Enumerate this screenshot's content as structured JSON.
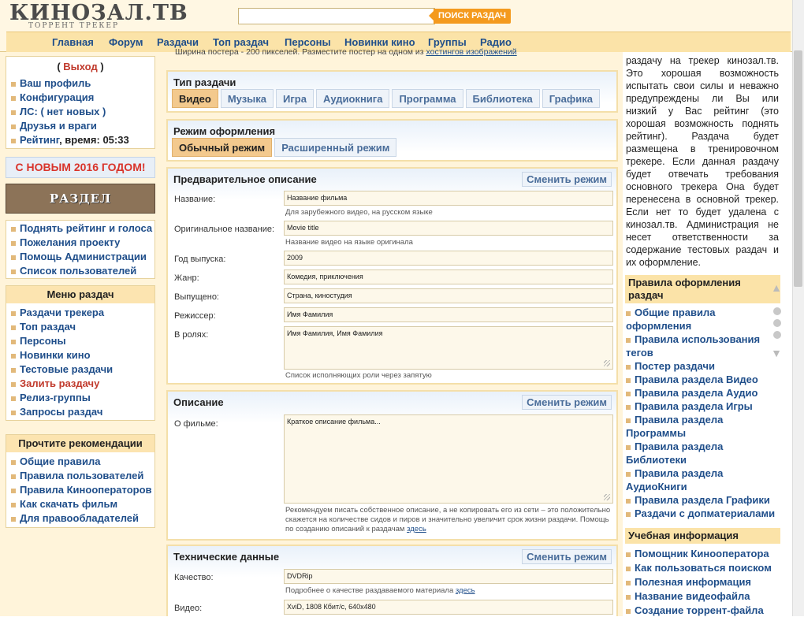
{
  "header": {
    "logo_main": "КИНОЗАЛ.ТВ",
    "logo_sub": "ТОРРЕНТ ТРЕКЕР",
    "search_placeholder": "",
    "search_button": "ПОИСК РАЗДАЧ",
    "nav": [
      "Главная",
      "Форум",
      "Раздачи",
      "Топ раздач",
      "Персоны",
      "Новинки кино",
      "Группы",
      "Радио"
    ]
  },
  "left": {
    "logout": "Выход",
    "user_links": [
      "Ваш профиль",
      "Конфигурация",
      "ЛС: ( нет новых )",
      "Друзья и враги"
    ],
    "rating_link": "Рейтинг",
    "rating_time_label": "время:",
    "rating_time": "05:33",
    "new_year": "С НОВЫМ 2016 ГОДОМ!",
    "mecen_banner": "РАЗДЕЛ МЕЦЕНАТОВ",
    "support_links": [
      "Поднять рейтинг и голоса",
      "Пожелания проекту",
      "Помощь Администрации",
      "Список пользователей"
    ],
    "menu_title": "Меню раздач",
    "menu_links": [
      "Раздачи трекера",
      "Топ раздач",
      "Персоны",
      "Новинки кино",
      "Тестовые раздачи",
      "Залить раздачу",
      "Релиз-группы",
      "Запросы раздач"
    ],
    "rec_title": "Прочтите рекомендации",
    "rec_links": [
      "Общие правила",
      "Правила пользователей",
      "Правила Кинооператоров",
      "Как скачать фильм",
      "Для правообладателей"
    ]
  },
  "main": {
    "top_note": "Ширина постера - 200 пикселей. Разместите постер на одном из",
    "top_note_link": "хостингов изображений",
    "type_title": "Тип раздачи",
    "types": [
      "Видео",
      "Музыка",
      "Игра",
      "Аудиокнига",
      "Программа",
      "Библиотека",
      "Графика"
    ],
    "mode_title": "Режим оформления",
    "modes": [
      "Обычный режим",
      "Расширенный режим"
    ],
    "change_mode": "Сменить режим",
    "pre_title": "Предварительное описание",
    "fields": {
      "name_label": "Название:",
      "name_value": "Название фильма",
      "name_hint": "Для зарубежного видео, на русском языке",
      "orig_label": "Оригинальное название:",
      "orig_value": "Movie title",
      "orig_hint": "Название видео на языке оригинала",
      "year_label": "Год выпуска:",
      "year_value": "2009",
      "genre_label": "Жанр:",
      "genre_value": "Комедия, приключения",
      "released_label": "Выпущено:",
      "released_value": "Страна, киностудия",
      "director_label": "Режиссер:",
      "director_value": "Имя Фамилия",
      "cast_label": "В ролях:",
      "cast_value": "Имя Фамилия, Имя Фамилия",
      "cast_hint": "Список исполняющих роли через запятую"
    },
    "desc_title": "Описание",
    "about_label": "О фильме:",
    "about_value": "Краткое описание фильма...",
    "about_hint": "Рекомендуем писать собственное описание, а не копировать его из сети – это положительно скажется на количестве сидов и пиров и значительно увеличит срок жизни раздачи. Помощь по созданию описаний к раздачам",
    "about_hint_link": "здесь",
    "tech_title": "Технические данные",
    "quality_label": "Качество:",
    "quality_value": "DVDRip",
    "quality_hint": "Подробнее о качестве раздаваемого материала",
    "quality_hint_link": "здесь",
    "video_label": "Видео:",
    "video_value": "XviD, 1808 Кбит/с, 640x480"
  },
  "right": {
    "text": "раздачу на трекер кинозал.тв. Это хорошая возможность испытать свои силы и неважно предупреждены ли Вы или низкий у Вас рейтинг (это хорошая возможность поднять рейтинг). Раздача будет размещена в тренировочном трекере. Если данная раздачу будет отвечать требования основного трекера Она будет перенесена в основной трекер. Если нет то будет удалена с кинозал.тв. Администрация не несет ответственности за содержание тестовых раздач и их оформление.",
    "rules_title": "Правила оформления раздач",
    "rules": [
      "Общие правила оформления",
      "Правила использования тегов",
      "Постер раздачи",
      "Правила раздела Видео",
      "Правила раздела Аудио",
      "Правила раздела Игры",
      "Правила раздела Программы",
      "Правила раздела Библиотеки",
      "Правила раздела АудиоКниги",
      "Правила раздела Графики",
      "Раздачи с допматериалами"
    ],
    "edu_title": "Учебная информация",
    "edu": [
      "Помощник Кинооператора",
      "Как пользоваться поиском",
      "Полезная информация",
      "Название видеофайла",
      "Создание торрент-файла"
    ]
  }
}
